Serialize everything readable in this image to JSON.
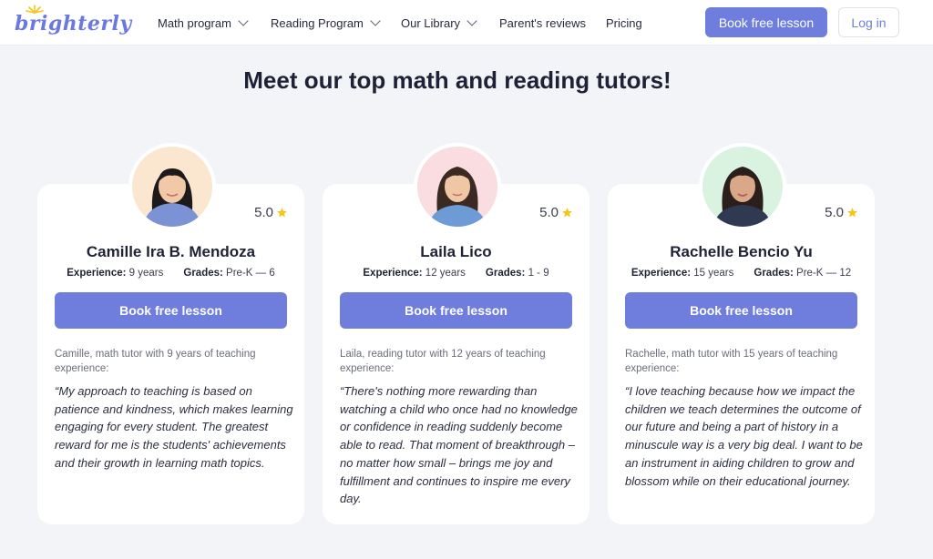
{
  "header": {
    "logo_text": "brighterly",
    "nav": [
      {
        "label": "Math program",
        "dropdown": true
      },
      {
        "label": "Reading Program",
        "dropdown": true
      },
      {
        "label": "Our Library",
        "dropdown": true
      },
      {
        "label": "Parent's reviews",
        "dropdown": false
      },
      {
        "label": "Pricing",
        "dropdown": false
      }
    ],
    "book_button": "Book free lesson",
    "login_button": "Log in"
  },
  "title": "Meet our top math and reading tutors!",
  "colors": {
    "accent": "#6f7ddd",
    "star": "#f5c518",
    "background": "#f3f4f8"
  },
  "tutors": [
    {
      "rating": "5.0",
      "name": "Camille Ira B. Mendoza",
      "experience_label": "Experience:",
      "experience": "9 years",
      "grades_label": "Grades:",
      "grades": "Pre-K — 6",
      "button": "Book free lesson",
      "intro": "Camille, math tutor with 9 years of teaching experience:",
      "quote": "“My approach to teaching is based on patience and kindness, which makes learning engaging for every student. The greatest reward for me is the students' achievements and their growth in learning math topics.",
      "avatar_bg": "#fbe7cf"
    },
    {
      "rating": "5.0",
      "name": "Laila Lico",
      "experience_label": "Experience:",
      "experience": "12 years",
      "grades_label": "Grades:",
      "grades": "1 - 9",
      "button": "Book free lesson",
      "intro": "Laila, reading tutor with 12 years of teaching experience:",
      "quote": "“There's nothing more rewarding than watching a child who once had no knowledge or confidence in reading suddenly become able to read. That moment of breakthrough – no matter how small – brings me joy and fulfillment and continues to inspire me every day.",
      "avatar_bg": "#f9dde0"
    },
    {
      "rating": "5.0",
      "name": "Rachelle Bencio Yu",
      "experience_label": "Experience:",
      "experience": "15 years",
      "grades_label": "Grades:",
      "grades": "Pre-K — 12",
      "button": "Book free lesson",
      "intro": "Rachelle, math tutor with 15 years of teaching experience:",
      "quote": "“I love teaching because how we impact the children we teach determines the outcome of our future and being a part of history in a minuscule way is a very big deal. I want to be an instrument in aiding children to grow and blossom while on their educational journey.",
      "avatar_bg": "#d9f3e0"
    }
  ]
}
